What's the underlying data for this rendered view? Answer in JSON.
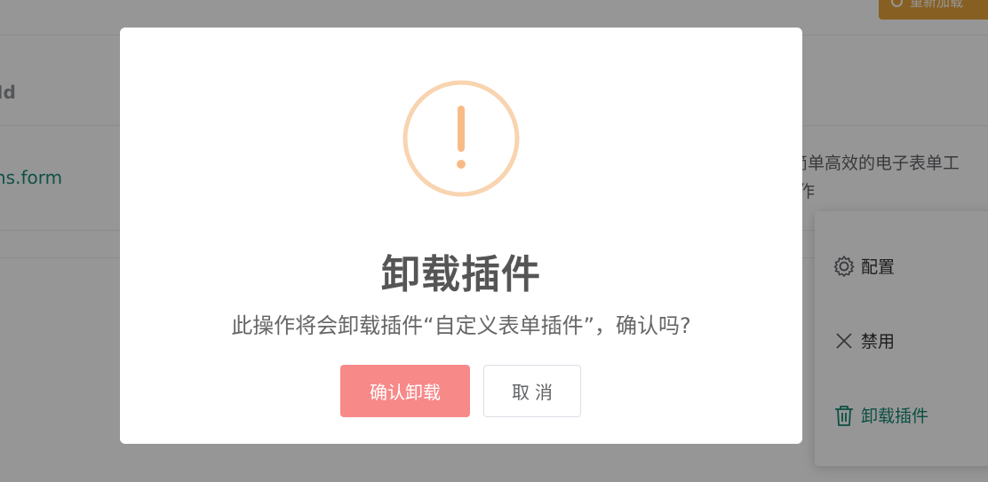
{
  "background": {
    "top_button_label": "重新加载",
    "column_header": "Id",
    "row_link": "ns.form",
    "row_description_line1": "简单高效的电子表单工",
    "row_description_line2": "作"
  },
  "dropdown": {
    "items": [
      {
        "label": "配置",
        "icon": "gear-icon"
      },
      {
        "label": "禁用",
        "icon": "close-icon"
      },
      {
        "label": "卸载插件",
        "icon": "trash-icon"
      }
    ]
  },
  "dialog": {
    "icon": "exclamation-circle-icon",
    "title": "卸载插件",
    "message": "此操作将会卸载插件“自定义表单插件”，确认吗?",
    "confirm_label": "确认卸载",
    "cancel_label": "取消"
  },
  "colors": {
    "warning": "#f8c89c",
    "confirm_button": "#f78989",
    "link": "#1b8a77",
    "top_button": "#e6a23c"
  }
}
